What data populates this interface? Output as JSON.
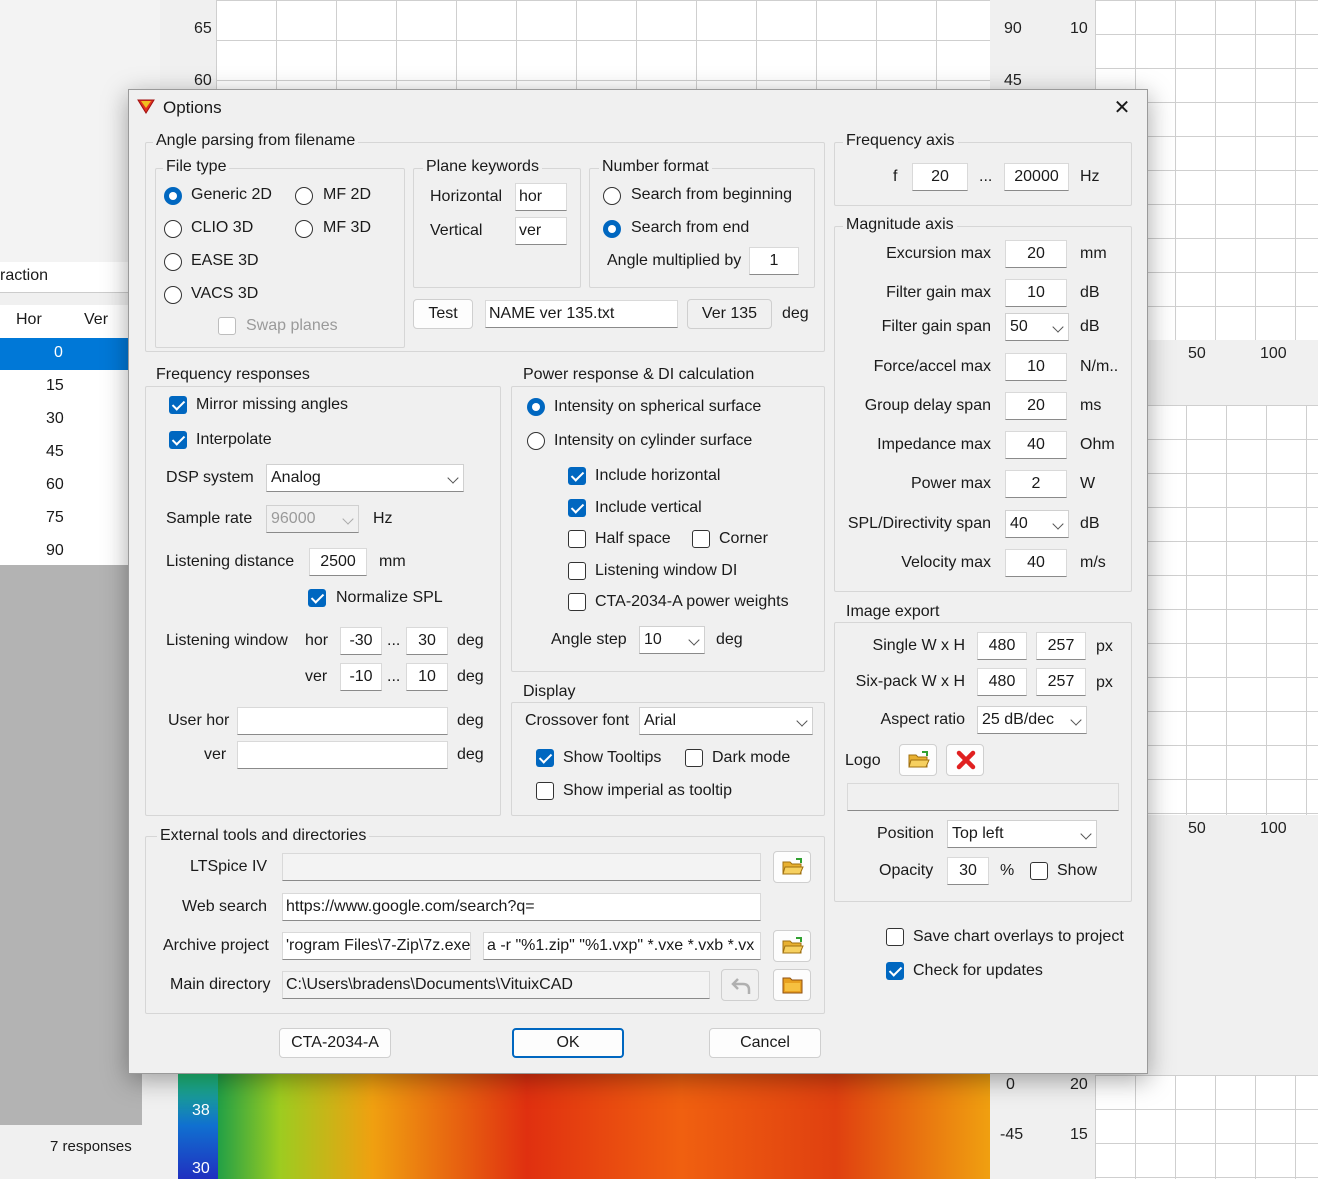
{
  "background": {
    "left_ticks": [
      "65",
      "60",
      "38",
      "30"
    ],
    "right_ticks_a": [
      "90",
      "45",
      "0",
      "-45"
    ],
    "right_ticks_b": [
      "10",
      "20",
      "15"
    ],
    "x_ticks_top": [
      "50",
      "100"
    ],
    "x_ticks_mid": [
      "50",
      "100"
    ],
    "table_title_fragment": "raction",
    "table_headers": [
      "Hor",
      "Ver"
    ],
    "table_rows": [
      "0",
      "15",
      "30",
      "45",
      "60",
      "75",
      "90"
    ],
    "responses_label": "7 responses"
  },
  "dialog": {
    "title": "Options",
    "close_glyph": "✕",
    "angle_parsing": {
      "title": "Angle parsing from filename",
      "file_type": {
        "title": "File type",
        "generic_2d": "Generic 2D",
        "mf_2d": "MF 2D",
        "clio_3d": "CLIO 3D",
        "mf_3d": "MF 3D",
        "ease_3d": "EASE 3D",
        "vacs_3d": "VACS 3D",
        "swap_planes": "Swap planes"
      },
      "plane_keywords": {
        "title": "Plane keywords",
        "horizontal_label": "Horizontal",
        "horizontal_value": "hor",
        "vertical_label": "Vertical",
        "vertical_value": "ver"
      },
      "number_format": {
        "title": "Number format",
        "search_beginning": "Search from beginning",
        "search_end": "Search from end",
        "angle_mult_label": "Angle multiplied by",
        "angle_mult_value": "1"
      },
      "test_button": "Test",
      "test_filename": "NAME ver 135.txt",
      "test_result": "Ver 135",
      "test_unit": "deg"
    },
    "frequency_responses": {
      "title": "Frequency responses",
      "mirror": "Mirror missing angles",
      "interpolate": "Interpolate",
      "dsp_label": "DSP system",
      "dsp_value": "Analog",
      "sample_rate_label": "Sample rate",
      "sample_rate_value": "96000",
      "sample_rate_unit": "Hz",
      "listening_distance_label": "Listening distance",
      "listening_distance_value": "2500",
      "listening_distance_unit": "mm",
      "normalize_spl": "Normalize SPL",
      "listening_window_label": "Listening window",
      "hor_label": "hor",
      "hor_from": "-30",
      "hor_to": "30",
      "ver_label": "ver",
      "ver_from": "-10",
      "ver_to": "10",
      "ellipsis": "...",
      "deg": "deg",
      "user_hor_label": "User hor",
      "user_hor_value": "",
      "user_ver_label": "ver",
      "user_ver_value": ""
    },
    "power_response": {
      "title": "Power response & DI calculation",
      "spherical": "Intensity on spherical surface",
      "cylinder": "Intensity on cylinder surface",
      "include_horizontal": "Include horizontal",
      "include_vertical": "Include vertical",
      "half_space": "Half space",
      "corner": "Corner",
      "listening_window_di": "Listening window DI",
      "cta_weights": "CTA-2034-A power weights",
      "angle_step_label": "Angle step",
      "angle_step_value": "10",
      "angle_step_unit": "deg"
    },
    "display": {
      "title": "Display",
      "crossover_font_label": "Crossover font",
      "crossover_font_value": "Arial",
      "show_tooltips": "Show Tooltips",
      "dark_mode": "Dark mode",
      "show_imperial": "Show imperial as tooltip"
    },
    "external_tools": {
      "title": "External tools and directories",
      "ltspice_label": "LTSpice IV",
      "ltspice_value": "",
      "web_search_label": "Web search",
      "web_search_value": "https://www.google.com/search?q=",
      "archive_label": "Archive project",
      "archive_path": "'rogram Files\\7-Zip\\7z.exe",
      "archive_args": "a -r \"%1.zip\" \"%1.vxp\" *.vxe *.vxb *.vx",
      "main_dir_label": "Main directory",
      "main_dir_value": "C:\\Users\\bradens\\Documents\\VituixCAD"
    },
    "frequency_axis": {
      "title": "Frequency axis",
      "f_label": "f",
      "from": "20",
      "ellipsis": "...",
      "to": "20000",
      "unit": "Hz"
    },
    "magnitude_axis": {
      "title": "Magnitude axis",
      "rows": [
        {
          "label": "Excursion max",
          "value": "20",
          "unit": "mm"
        },
        {
          "label": "Filter gain max",
          "value": "10",
          "unit": "dB"
        },
        {
          "label": "Filter gain span",
          "value": "50",
          "unit": "dB"
        },
        {
          "label": "Force/accel max",
          "value": "10",
          "unit": "N/m.."
        },
        {
          "label": "Group delay span",
          "value": "20",
          "unit": "ms"
        },
        {
          "label": "Impedance max",
          "value": "40",
          "unit": "Ohm"
        },
        {
          "label": "Power max",
          "value": "2",
          "unit": "W"
        },
        {
          "label": "SPL/Directivity span",
          "value": "40",
          "unit": "dB"
        },
        {
          "label": "Velocity max",
          "value": "40",
          "unit": "m/s"
        }
      ]
    },
    "image_export": {
      "title": "Image export",
      "single_label": "Single W x H",
      "single_w": "480",
      "single_h": "257",
      "sixpack_label": "Six-pack W x H",
      "sixpack_w": "480",
      "sixpack_h": "257",
      "px": "px",
      "aspect_label": "Aspect ratio",
      "aspect_value": "25 dB/dec",
      "logo_label": "Logo",
      "logo_path": "",
      "position_label": "Position",
      "position_value": "Top left",
      "opacity_label": "Opacity",
      "opacity_value": "30",
      "opacity_unit": "%",
      "show": "Show"
    },
    "save_overlays": "Save chart overlays to project",
    "check_updates": "Check for updates",
    "buttons": {
      "cta": "CTA-2034-A",
      "ok": "OK",
      "cancel": "Cancel"
    },
    "colors": {
      "accent": "#0067c0",
      "close_red": "#e02020"
    }
  }
}
